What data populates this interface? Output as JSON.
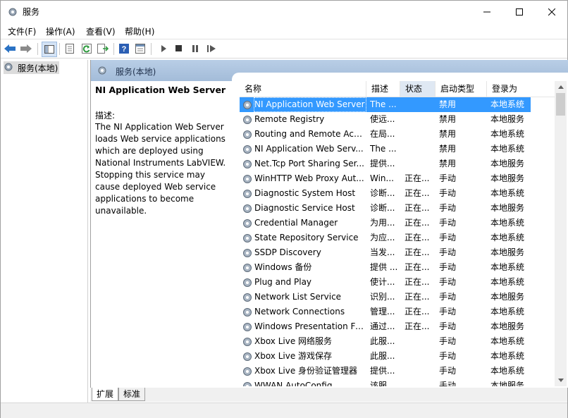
{
  "window": {
    "title": "服务",
    "icon": "gear-icon"
  },
  "menu": [
    "文件(F)",
    "操作(A)",
    "查看(V)",
    "帮助(H)"
  ],
  "toolbar": {
    "buttons": [
      "back-icon",
      "forward-icon",
      "show-hide-tree-icon",
      "properties-icon",
      "refresh-icon",
      "export-list-icon",
      "help-icon",
      "view-icon",
      "start-service-icon",
      "stop-service-icon",
      "pause-service-icon",
      "restart-service-icon"
    ]
  },
  "tree": {
    "root_label": "服务(本地)"
  },
  "banner": {
    "title": "服务(本地)"
  },
  "details": {
    "service_name": "NI Application Web Server",
    "description_label": "描述:",
    "description": "The NI Application Web Server loads Web service applications which are deployed using National Instruments LabVIEW. Stopping this service may cause deployed Web service applications to become unavailable."
  },
  "table": {
    "columns": [
      "名称",
      "描述",
      "状态",
      "启动类型",
      "登录为"
    ],
    "sorted_column": "状态",
    "rows": [
      {
        "name": "NI Application Web Server",
        "desc": "The ...",
        "status": "",
        "startup": "禁用",
        "logon": "本地系统",
        "selected": true
      },
      {
        "name": "Remote Registry",
        "desc": "使远...",
        "status": "",
        "startup": "禁用",
        "logon": "本地服务"
      },
      {
        "name": "Routing and Remote Acc...",
        "desc": "在局...",
        "status": "",
        "startup": "禁用",
        "logon": "本地系统"
      },
      {
        "name": "NI Application Web Serv...",
        "desc": "The ...",
        "status": "",
        "startup": "禁用",
        "logon": "本地系统"
      },
      {
        "name": "Net.Tcp Port Sharing Ser...",
        "desc": "提供...",
        "status": "",
        "startup": "禁用",
        "logon": "本地服务"
      },
      {
        "name": "WinHTTP Web Proxy Aut...",
        "desc": "Win...",
        "status": "正在...",
        "startup": "手动",
        "logon": "本地服务"
      },
      {
        "name": "Diagnostic System Host",
        "desc": "诊断...",
        "status": "正在...",
        "startup": "手动",
        "logon": "本地系统"
      },
      {
        "name": "Diagnostic Service Host",
        "desc": "诊断...",
        "status": "正在...",
        "startup": "手动",
        "logon": "本地服务"
      },
      {
        "name": "Credential Manager",
        "desc": "为用...",
        "status": "正在...",
        "startup": "手动",
        "logon": "本地系统"
      },
      {
        "name": "State Repository Service",
        "desc": "为应...",
        "status": "正在...",
        "startup": "手动",
        "logon": "本地系统"
      },
      {
        "name": "SSDP Discovery",
        "desc": "当发...",
        "status": "正在...",
        "startup": "手动",
        "logon": "本地服务"
      },
      {
        "name": "Windows 备份",
        "desc": "提供 ...",
        "status": "正在...",
        "startup": "手动",
        "logon": "本地系统"
      },
      {
        "name": "Plug and Play",
        "desc": "使计...",
        "status": "正在...",
        "startup": "手动",
        "logon": "本地系统"
      },
      {
        "name": "Network List Service",
        "desc": "识别...",
        "status": "正在...",
        "startup": "手动",
        "logon": "本地服务"
      },
      {
        "name": "Network Connections",
        "desc": "管理...",
        "status": "正在...",
        "startup": "手动",
        "logon": "本地系统"
      },
      {
        "name": "Windows Presentation Fo...",
        "desc": "通过...",
        "status": "正在...",
        "startup": "手动",
        "logon": "本地服务"
      },
      {
        "name": "Xbox Live 网络服务",
        "desc": "此服...",
        "status": "",
        "startup": "手动",
        "logon": "本地系统"
      },
      {
        "name": "Xbox Live 游戏保存",
        "desc": "此服...",
        "status": "",
        "startup": "手动",
        "logon": "本地系统"
      },
      {
        "name": "Xbox Live 身份验证管理器",
        "desc": "提供...",
        "status": "",
        "startup": "手动",
        "logon": "本地系统"
      },
      {
        "name": "WWAN AutoConfig",
        "desc": "该服...",
        "status": "",
        "startup": "手动",
        "logon": "本地服务"
      }
    ]
  },
  "tabs": [
    "扩展",
    "标准"
  ],
  "colors": {
    "selection": "#3399ff",
    "banner": "#b9cee6",
    "nav_arrow": "#2a72c4"
  }
}
